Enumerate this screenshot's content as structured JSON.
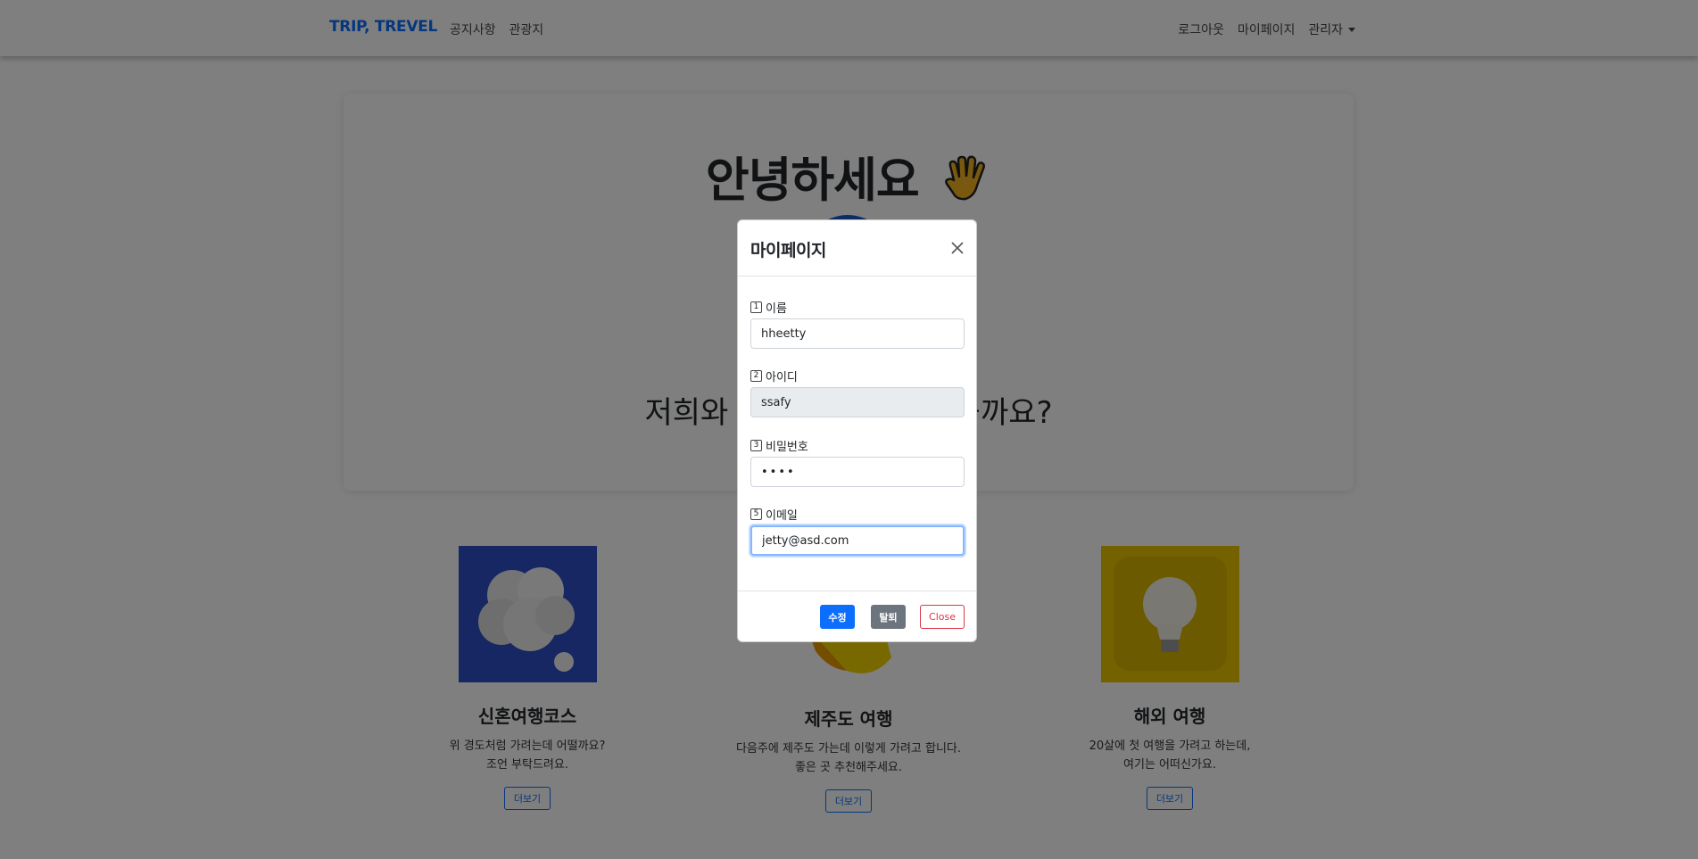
{
  "navbar": {
    "brand": "TRIP, TREVEL",
    "left_links": [
      "공지사항",
      "관광지"
    ],
    "right_links": {
      "logout": "로그아웃",
      "mypage": "마이페이지",
      "admin": "관리자"
    }
  },
  "hero": {
    "title": "안녕하세요",
    "subtitle": "저희와 함께 여행을 떠나볼까요?"
  },
  "cards": [
    {
      "title": "신혼여행코스",
      "text_line1": "위 경도처럼 가려는데 어떨까요?",
      "text_line2": "조언 부탁드려요.",
      "button": "더보기"
    },
    {
      "title": "제주도 여행",
      "text_line1": "다음주에 제주도 가는데 이렇게 가려고 합니다.",
      "text_line2": "좋은 곳 추천해주세요.",
      "button": "더보기"
    },
    {
      "title": "해외 여행",
      "text_line1": "20살에 첫 여행을 가려고 하는데,",
      "text_line2": "여기는 어떠신가요.",
      "button": "더보기"
    }
  ],
  "modal": {
    "title": "마이페이지",
    "fields": [
      {
        "number": "1",
        "label": "이름",
        "value": "hheetty"
      },
      {
        "number": "2",
        "label": "아이디",
        "value": "ssafy"
      },
      {
        "number": "3",
        "label": "비밀번호",
        "value": "••••"
      },
      {
        "number": "5",
        "label": "이메일",
        "value": "jetty@asd.com"
      }
    ],
    "buttons": {
      "update": "수정",
      "withdraw": "탈퇴",
      "close": "Close"
    }
  },
  "colors": {
    "primary": "#0d6efd",
    "secondary": "#6c757d",
    "danger": "#dc3545",
    "backdrop": "rgba(0,0,0,0.5)"
  }
}
